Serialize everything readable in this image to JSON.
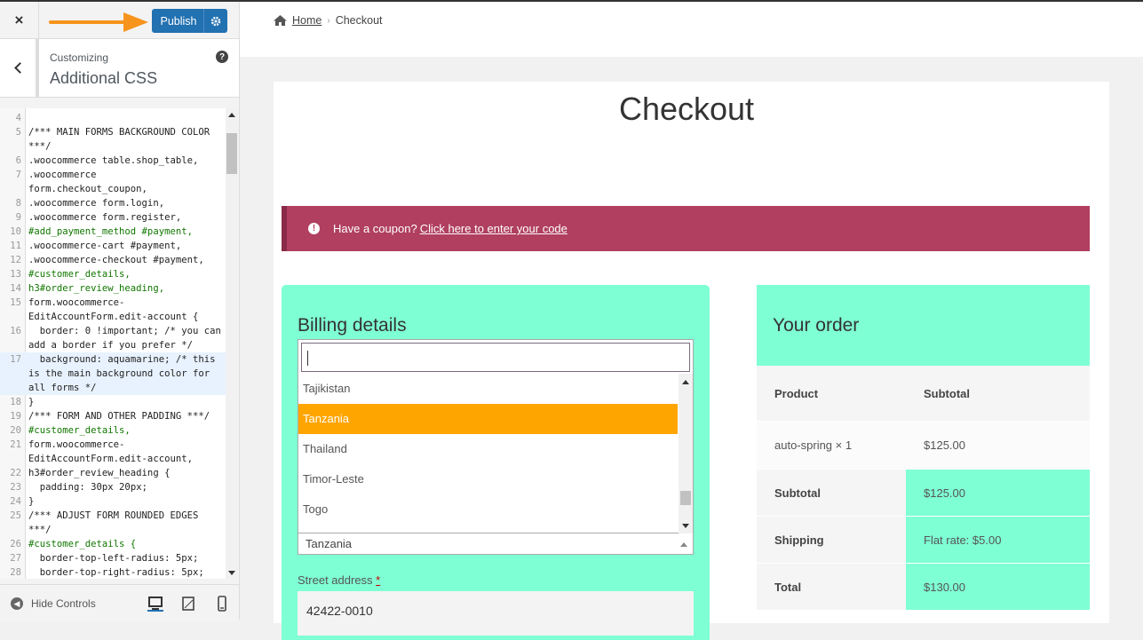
{
  "sidebar": {
    "close_icon": "×",
    "publish_label": "Publish",
    "customizing_label": "Customizing",
    "section_title": "Additional CSS",
    "help_icon": "?",
    "hide_controls_label": "Hide Controls"
  },
  "code_lines": [
    {
      "n": "4",
      "t": ""
    },
    {
      "n": "5",
      "t": "/*** MAIN FORMS BACKGROUND COLOR ***/",
      "cls": "cm"
    },
    {
      "n": "6",
      "t": ".woocommerce table.shop_table,"
    },
    {
      "n": "7",
      "t": ".woocommerce\nform.checkout_coupon,"
    },
    {
      "n": "8",
      "t": ".woocommerce form.login,"
    },
    {
      "n": "9",
      "t": ".woocommerce form.register,"
    },
    {
      "n": "10",
      "t": "#add_payment_method #payment,",
      "cls": "kw"
    },
    {
      "n": "11",
      "t": ".woocommerce-cart #payment,"
    },
    {
      "n": "12",
      "t": ".woocommerce-checkout #payment,"
    },
    {
      "n": "13",
      "t": "#customer_details,",
      "cls": "kw"
    },
    {
      "n": "14",
      "t": "h3#order_review_heading,",
      "cls": "kw"
    },
    {
      "n": "15",
      "t": "form.woocommerce-\nEditAccountForm.edit-account {"
    },
    {
      "n": "16",
      "t": "  border: 0 !important; /* you can add a border if you prefer */"
    },
    {
      "n": "17",
      "t": "  background: aquamarine; /* this is the main background color for all forms */",
      "hl": true
    },
    {
      "n": "18",
      "t": "}"
    },
    {
      "n": "19",
      "t": "/*** FORM AND OTHER PADDING ***/",
      "cls": "cm"
    },
    {
      "n": "20",
      "t": "#customer_details,",
      "cls": "kw"
    },
    {
      "n": "21",
      "t": "form.woocommerce-\nEditAccountForm.edit-account,"
    },
    {
      "n": "22",
      "t": "h3#order_review_heading {"
    },
    {
      "n": "23",
      "t": "  padding: 30px 20px;"
    },
    {
      "n": "24",
      "t": "}"
    },
    {
      "n": "25",
      "t": "/*** ADJUST FORM ROUNDED EDGES ***/",
      "cls": "cm"
    },
    {
      "n": "26",
      "t": "#customer_details {",
      "cls": "kw"
    },
    {
      "n": "27",
      "t": "  border-top-left-radius: 5px;"
    },
    {
      "n": "28",
      "t": "  border-top-right-radius: 5px;"
    }
  ],
  "preview": {
    "breadcrumb_home": "Home",
    "breadcrumb_sep": "›",
    "breadcrumb_current": "Checkout",
    "page_title": "Checkout",
    "coupon_text": "Have a coupon?",
    "coupon_link": "Click here to enter your code",
    "billing_title": "Billing details",
    "country_options": [
      "Tajikistan",
      "Tanzania",
      "Thailand",
      "Timor-Leste",
      "Togo"
    ],
    "selected_option_index": 1,
    "country_value": "Tanzania",
    "street_label": "Street address",
    "street_required": "*",
    "street_value": "42422-0010",
    "order_title": "Your order",
    "order_rows": [
      {
        "label": "Product",
        "value": "Subtotal",
        "bold": true,
        "bg": "#f5f5f5",
        "bg2": "#f5f5f5"
      },
      {
        "label": "auto-spring  × 1",
        "value": "$125.00",
        "bold": false,
        "bg": "#fbfbfb",
        "bg2": "#fbfbfb"
      },
      {
        "label": "Subtotal",
        "value": "$125.00",
        "bold": true,
        "bg": "#f5f5f5",
        "bg2": "#7fffd4"
      },
      {
        "label": "Shipping",
        "value": "Flat rate: $5.00",
        "bold": true,
        "bg": "#f5f5f5",
        "bg2": "#7fffd4"
      },
      {
        "label": "Total",
        "value": "$130.00",
        "bold": true,
        "bg": "#f5f5f5",
        "bg2": "#7fffd4"
      }
    ]
  },
  "colors": {
    "accent": "#2271b1",
    "billing_bg": "#7fffd4",
    "coupon_bg": "#b03f60",
    "selected_option": "#ffa500",
    "arrow": "#f7941d"
  }
}
